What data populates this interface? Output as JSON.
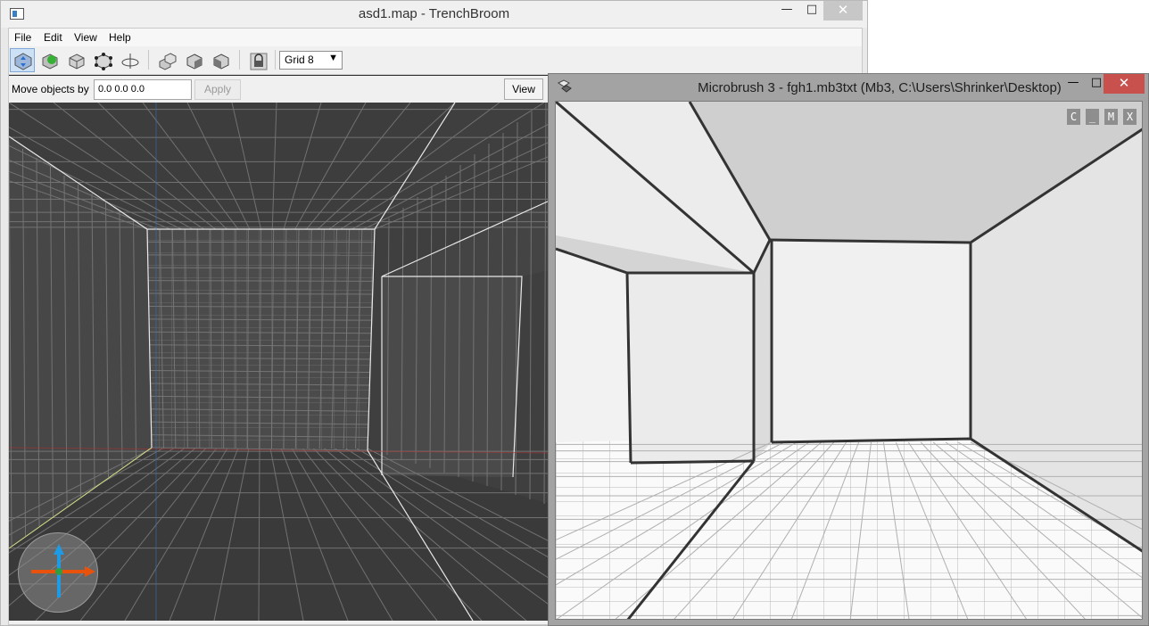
{
  "trenchbroom": {
    "title": "asd1.map - TrenchBroom",
    "window_controls": {
      "minimize": "—",
      "maximize": "□",
      "close": "✕"
    },
    "menu": [
      "File",
      "Edit",
      "View",
      "Help"
    ],
    "toolbar": {
      "tools": [
        "move-tool-icon",
        "create-entity-icon",
        "brush-icon",
        "vertex-tool-icon",
        "rotate-tool-icon",
        "duplicate-icon",
        "flip-icon",
        "texture-lock-icon"
      ],
      "lock_icon": "padlock-icon",
      "grid_value": "Grid 8"
    },
    "move_bar": {
      "label": "Move objects by",
      "value": "0.0 0.0 0.0",
      "apply_label": "Apply",
      "view_label": "View"
    },
    "gizmo_colors": {
      "x": "#e8520a",
      "y": "#1f9be6",
      "z": "#2ea043"
    }
  },
  "microbrush": {
    "title": "Microbrush 3 - fgh1.mb3txt (Mb3, C:\\Users\\Shrinker\\Desktop)",
    "window_controls": {
      "minimize": "—",
      "maximize": "□",
      "close": "✕"
    },
    "viewport_buttons": [
      "C",
      "_",
      "M",
      "X"
    ]
  }
}
